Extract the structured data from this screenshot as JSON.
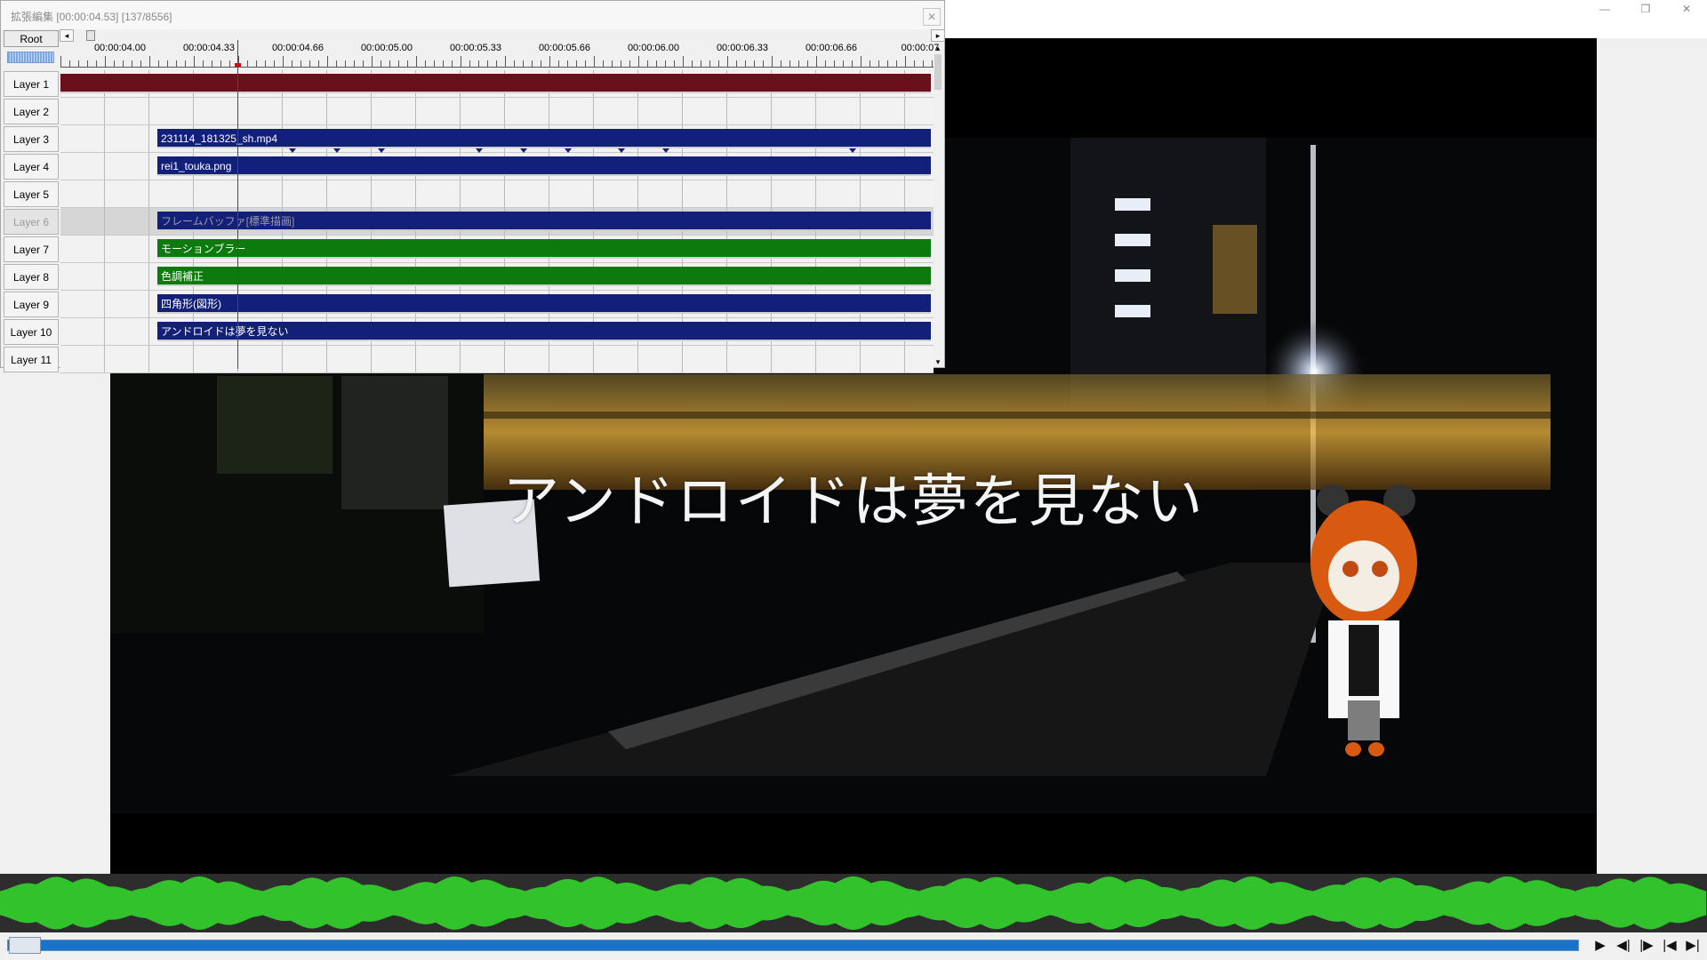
{
  "main_window": {
    "controls": {
      "minimize": "—",
      "restore": "❐",
      "close": "✕"
    }
  },
  "preview": {
    "overlay_text": "アンドロイドは夢を見ない"
  },
  "extended_edit": {
    "title": "拡張編集 [00:00:04.53] [137/8556]",
    "close_glyph": "✕",
    "root_label": "Root",
    "ruler_labels": [
      "00:00:04.00",
      "00:00:04.33",
      "00:00:04.66",
      "00:00:05.00",
      "00:00:05.33",
      "00:00:05.66",
      "00:00:06.00",
      "00:00:06.33",
      "00:00:06.66",
      "00:00:07"
    ],
    "layers": [
      {
        "label": "Layer 1",
        "clip": "",
        "color": "red"
      },
      {
        "label": "Layer 2",
        "clip": null
      },
      {
        "label": "Layer 3",
        "clip": "231114_181325_sh.mp4",
        "color": "blue"
      },
      {
        "label": "Layer 4",
        "clip": "rei1_touka.png",
        "color": "blue"
      },
      {
        "label": "Layer 5",
        "clip": null
      },
      {
        "label": "Layer 6",
        "clip": "フレームバッファ[標準描画]",
        "color": "blue",
        "disabled": true
      },
      {
        "label": "Layer 7",
        "clip": "モーションブラー",
        "color": "green"
      },
      {
        "label": "Layer 8",
        "clip": "色調補正",
        "color": "green"
      },
      {
        "label": "Layer 9",
        "clip": "四角形(図形)",
        "color": "blue"
      },
      {
        "label": "Layer 10",
        "clip": "アンドロイドは夢を見ない",
        "color": "blue"
      },
      {
        "label": "Layer 11",
        "clip": null
      }
    ]
  },
  "transport": {
    "play": "▶",
    "prev_frame": "◀|",
    "next_frame": "|▶",
    "to_start": "|◀",
    "to_end": "▶|"
  },
  "colors": {
    "clip_red": "#6c0f1d",
    "clip_blue": "#13207a",
    "clip_green": "#0d7a0d",
    "waveform": "#34e82c",
    "seek": "#1a73c9",
    "cursor": "#d01010"
  }
}
